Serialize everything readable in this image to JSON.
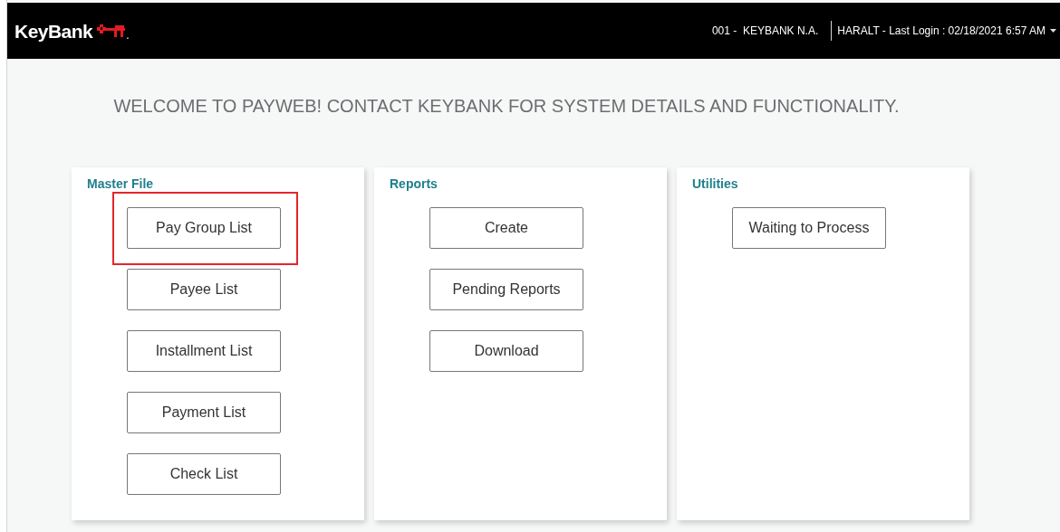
{
  "header": {
    "logo": {
      "text": "KeyBank",
      "suffix": "."
    },
    "bank": "001 -  KEYBANK N.A.",
    "user": "HARALT - Last Login : 02/18/2021 6:57 AM"
  },
  "welcome": "WELCOME TO PAYWEB! CONTACT KEYBANK FOR SYSTEM DETAILS AND FUNCTIONALITY.",
  "cards": [
    {
      "title": "Master File",
      "buttons": [
        {
          "label": "Pay Group List",
          "highlighted": true
        },
        {
          "label": "Payee List",
          "highlighted": false
        },
        {
          "label": "Installment List",
          "highlighted": false
        },
        {
          "label": "Payment List",
          "highlighted": false
        },
        {
          "label": "Check List",
          "highlighted": false
        }
      ]
    },
    {
      "title": "Reports",
      "buttons": [
        {
          "label": "Create",
          "highlighted": false
        },
        {
          "label": "Pending Reports",
          "highlighted": false
        },
        {
          "label": "Download",
          "highlighted": false
        }
      ]
    },
    {
      "title": "Utilities",
      "buttons": [
        {
          "label": "Waiting to Process",
          "highlighted": false
        }
      ]
    }
  ]
}
